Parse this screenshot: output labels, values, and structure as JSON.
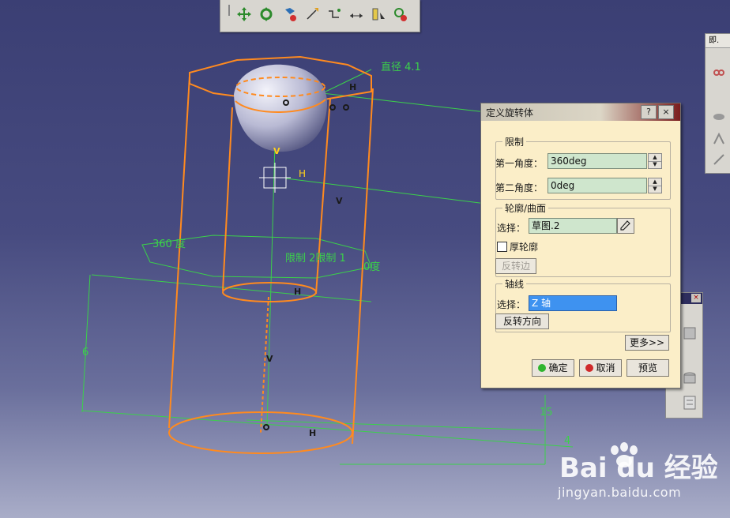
{
  "viewport": {
    "annotations": {
      "diameter": "直径 4.1",
      "h_top": "H",
      "h_mid": "H",
      "v_top": "V",
      "v_right": "V",
      "v_lower": "V",
      "angle_360": "360 度",
      "limit_label": "限制 2限制 1",
      "angle_0": "0度",
      "h_bottom_inner": "H",
      "h_bottom": "H",
      "dim_6": "6",
      "dim_15": "15",
      "dim_4": "4"
    }
  },
  "dialog": {
    "title": "定义旋转体",
    "help": "?",
    "close": "×",
    "limits": {
      "legend": "限制",
      "first_angle_label": "第一角度：",
      "first_angle_value": "360deg",
      "second_angle_label": "第二角度：",
      "second_angle_value": "0deg"
    },
    "profile": {
      "legend": "轮廓/曲面",
      "select_label": "选择：",
      "select_value": "草图.2",
      "thick_label": "厚轮廓",
      "reverse_side": "反转边"
    },
    "axis": {
      "legend": "轴线",
      "select_label": "选择：",
      "select_value": "Z 轴",
      "reverse_direction": "反转方向"
    },
    "more": "更多>>",
    "ok": "确定",
    "cancel": "取消",
    "preview": "预览"
  },
  "side_panel": {
    "title": "即."
  },
  "watermark": {
    "brand": "Bai du 经验",
    "url": "jingyan.baidu.com"
  },
  "colors": {
    "accent_orange": "#ff8a1f",
    "green": "#35d14a",
    "selection_blue": "#3e92f0",
    "field_green": "#cfe6cd"
  }
}
